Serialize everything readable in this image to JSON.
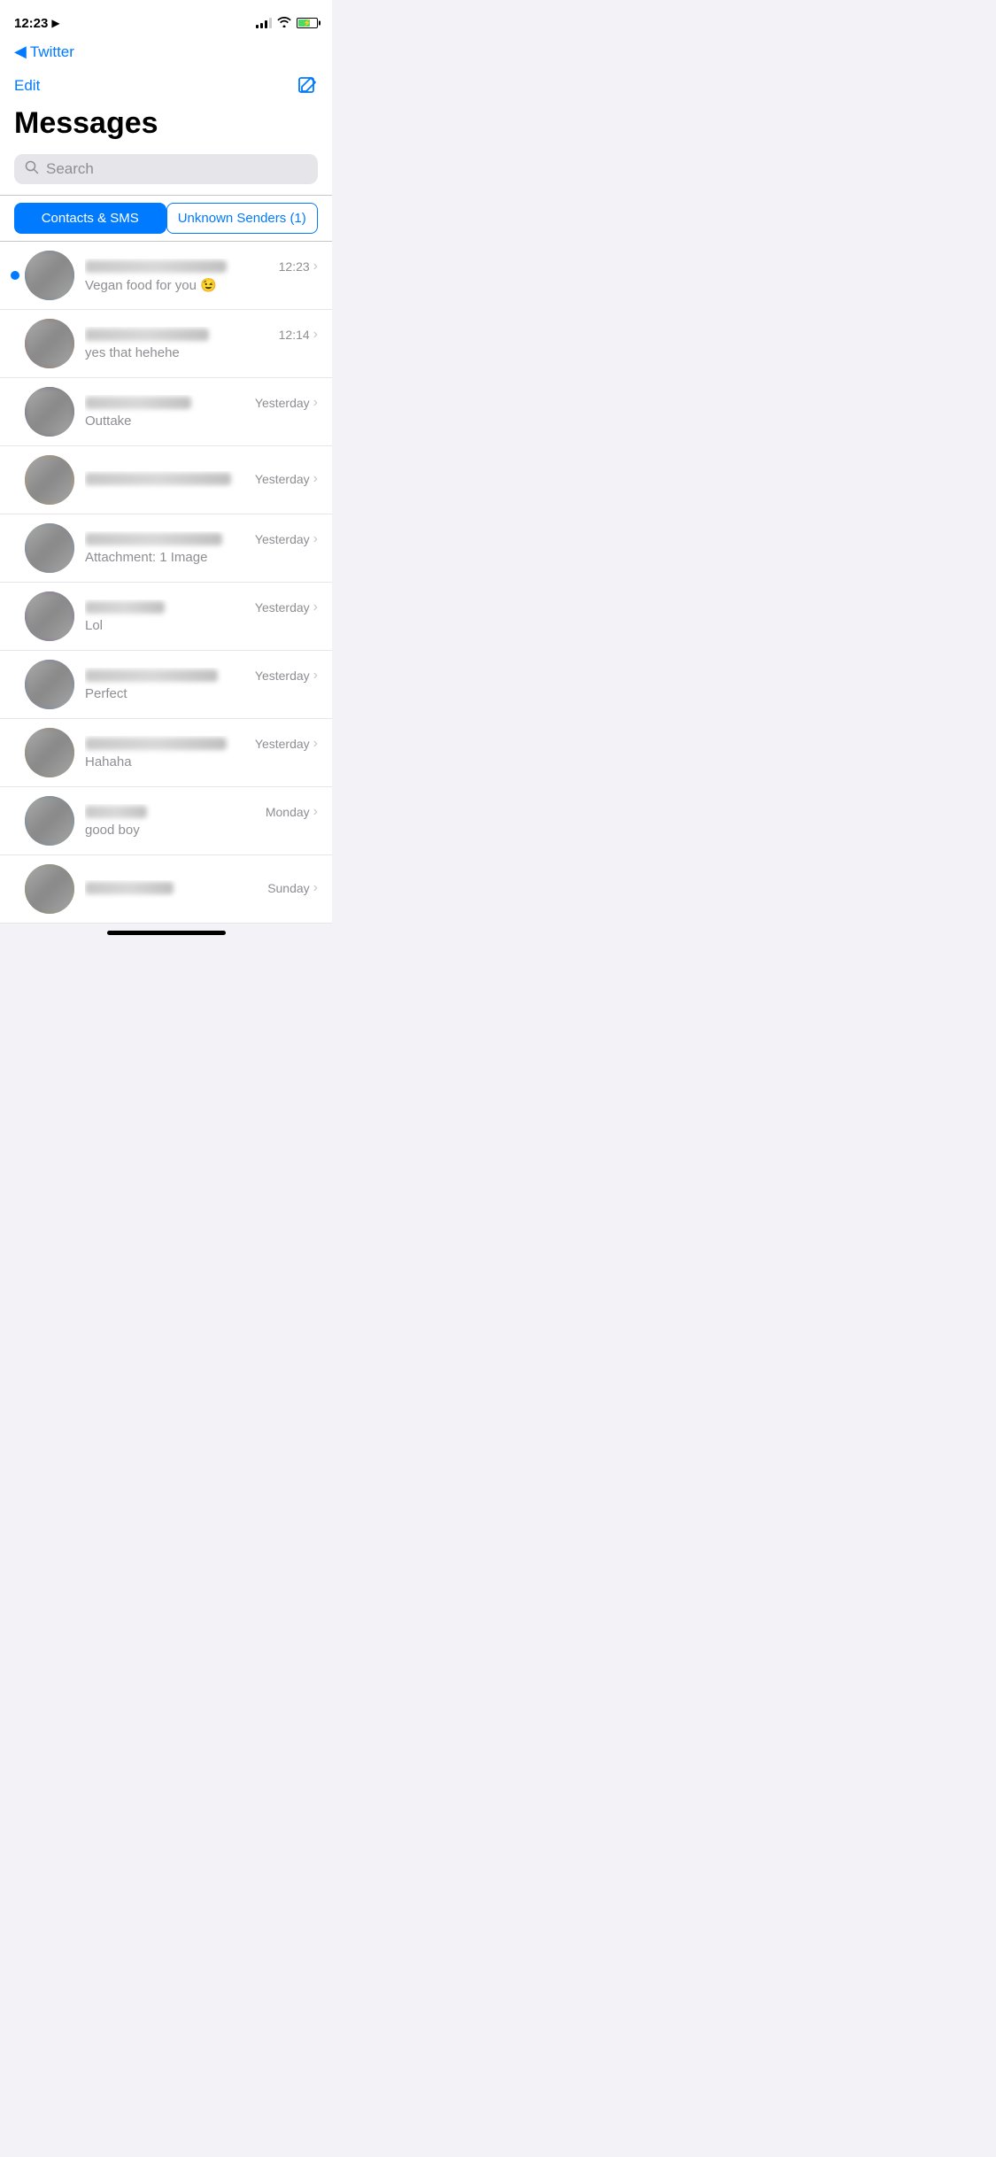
{
  "statusBar": {
    "time": "12:23",
    "locationIcon": "▶"
  },
  "twitterBar": {
    "backArrow": "◀",
    "label": "Twitter"
  },
  "navBar": {
    "editLabel": "Edit",
    "composeTitle": "compose-message"
  },
  "header": {
    "title": "Messages"
  },
  "search": {
    "placeholder": "Search"
  },
  "tabs": {
    "contactsSms": "Contacts & SMS",
    "unknownSenders": "Unknown Senders (1)"
  },
  "messages": [
    {
      "id": 1,
      "unread": true,
      "avatarClass": "avatar-1",
      "senderWidth": "160",
      "time": "12:23",
      "preview": "Vegan food for you 😉"
    },
    {
      "id": 2,
      "unread": false,
      "avatarClass": "avatar-2",
      "senderWidth": "140",
      "time": "12:14",
      "preview": "yes that hehehe"
    },
    {
      "id": 3,
      "unread": false,
      "avatarClass": "avatar-3",
      "senderWidth": "120",
      "time": "Yesterday",
      "preview": "Outtake"
    },
    {
      "id": 4,
      "unread": false,
      "avatarClass": "avatar-4",
      "senderWidth": "165",
      "time": "Yesterday",
      "preview": ""
    },
    {
      "id": 5,
      "unread": false,
      "avatarClass": "avatar-5",
      "senderWidth": "155",
      "time": "Yesterday",
      "preview": "Attachment: 1 Image"
    },
    {
      "id": 6,
      "unread": false,
      "avatarClass": "avatar-6",
      "senderWidth": "90",
      "time": "Yesterday",
      "preview": "Lol"
    },
    {
      "id": 7,
      "unread": false,
      "avatarClass": "avatar-7",
      "senderWidth": "150",
      "time": "Yesterday",
      "preview": "Perfect"
    },
    {
      "id": 8,
      "unread": false,
      "avatarClass": "avatar-8",
      "senderWidth": "160",
      "time": "Yesterday",
      "preview": "Hahaha"
    },
    {
      "id": 9,
      "unread": false,
      "avatarClass": "avatar-9",
      "senderWidth": "70",
      "time": "Monday",
      "preview": "good boy"
    },
    {
      "id": 10,
      "unread": false,
      "avatarClass": "avatar-10",
      "senderWidth": "100",
      "time": "Sunday",
      "preview": ""
    }
  ],
  "homeIndicator": {
    "label": "home-bar"
  }
}
